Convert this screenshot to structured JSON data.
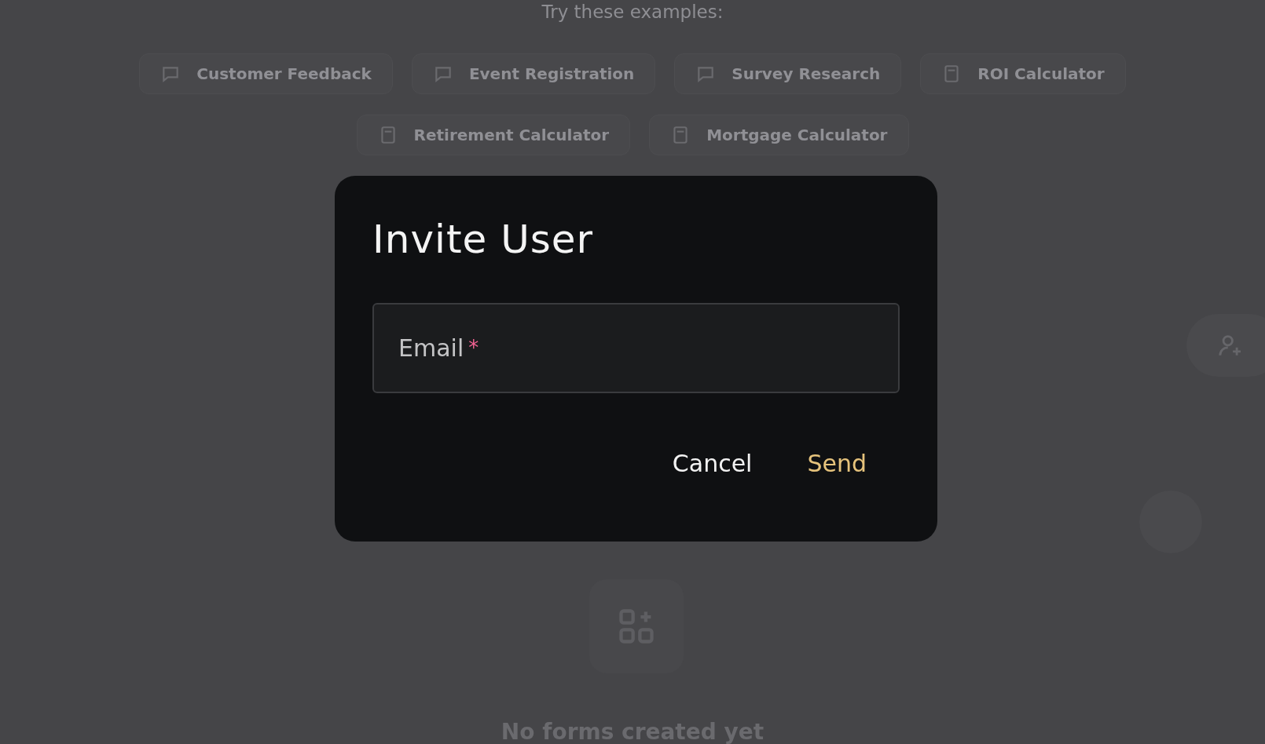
{
  "background": {
    "prompt": "Try these examples:",
    "examples": [
      {
        "label": "Customer Feedback",
        "kind": "chat"
      },
      {
        "label": "Event Registration",
        "kind": "chat"
      },
      {
        "label": "Survey Research",
        "kind": "chat"
      },
      {
        "label": "ROI Calculator",
        "kind": "calculator"
      },
      {
        "label": "Retirement Calculator",
        "kind": "calculator"
      },
      {
        "label": "Mortgage Calculator",
        "kind": "calculator"
      }
    ],
    "empty_state": "No forms created yet"
  },
  "dialog": {
    "title": "Invite User",
    "field": {
      "label": "Email",
      "required_mark": "*"
    },
    "buttons": [
      {
        "label": "Cancel",
        "kind": "secondary"
      },
      {
        "label": "Send",
        "kind": "primary"
      }
    ]
  }
}
